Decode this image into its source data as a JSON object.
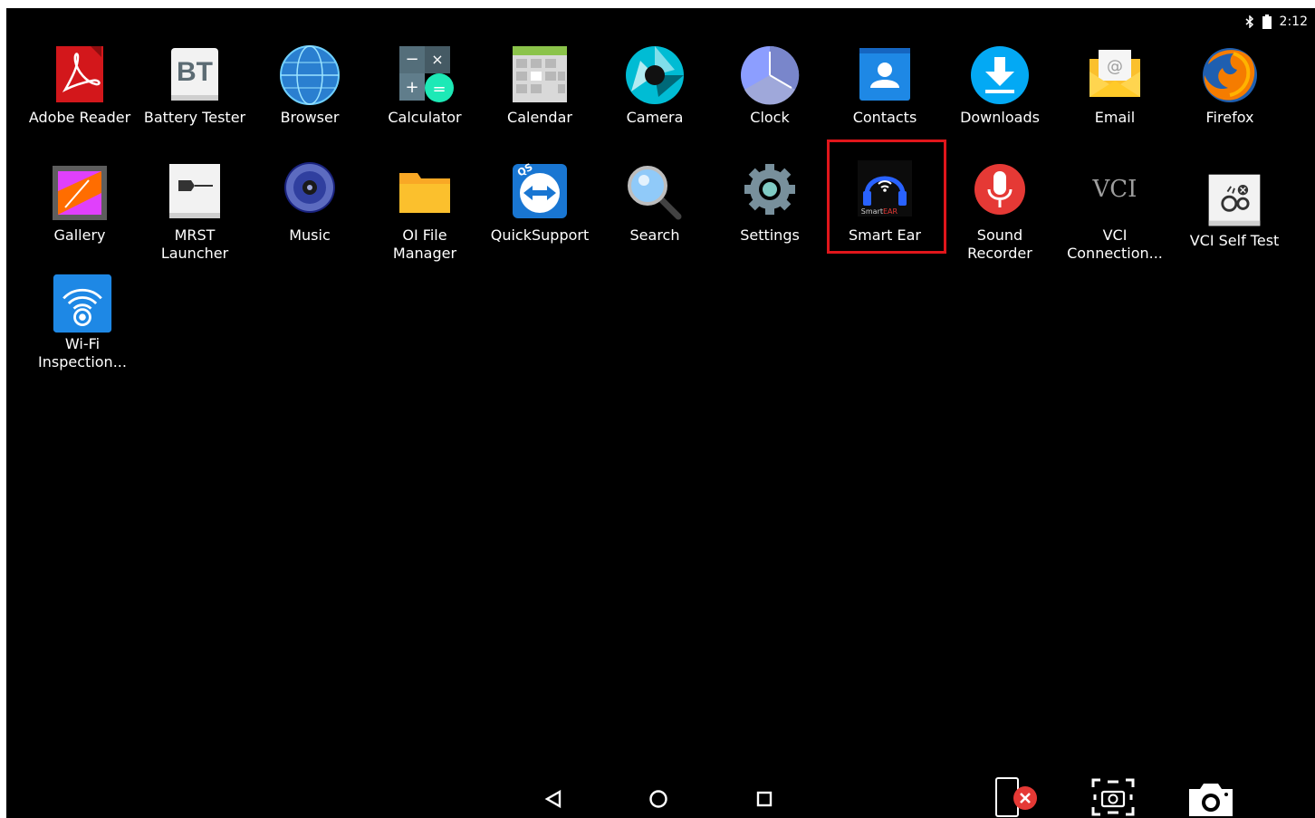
{
  "status_bar": {
    "time": "2:12",
    "icons": [
      "bluetooth-icon",
      "battery-icon"
    ]
  },
  "apps": [
    {
      "label": "Adobe Reader"
    },
    {
      "label": "Battery Tester",
      "icon_text": "BT"
    },
    {
      "label": "Browser"
    },
    {
      "label": "Calculator"
    },
    {
      "label": "Calendar"
    },
    {
      "label": "Camera"
    },
    {
      "label": "Clock"
    },
    {
      "label": "Contacts"
    },
    {
      "label": "Downloads"
    },
    {
      "label": "Email"
    },
    {
      "label": "Firefox"
    },
    {
      "label": "Gallery"
    },
    {
      "label": "MRST\nLauncher"
    },
    {
      "label": "Music"
    },
    {
      "label": "OI File\nManager"
    },
    {
      "label": "QuickSupport",
      "icon_text": "QS"
    },
    {
      "label": "Search"
    },
    {
      "label": "Settings"
    },
    {
      "label": "Smart Ear",
      "icon_text_prefix": "Smart",
      "icon_text_accent": "EAR"
    },
    {
      "label": "Sound\nRecorder"
    },
    {
      "label": "VCI\nConnection...",
      "icon_text": "VCI"
    },
    {
      "label": "VCI Self Test"
    },
    {
      "label": "Wi-Fi\nInspection..."
    }
  ],
  "highlight": {
    "target": "Smart Ear",
    "color": "#e0161b"
  },
  "nav_bar": {
    "buttons": [
      "back-icon",
      "home-icon",
      "recents-icon",
      "close-app-icon",
      "screenshot-region-icon",
      "camera-capture-icon"
    ]
  },
  "colors": {
    "background": "#000000",
    "text": "#ffffff",
    "accent_red": "#e0161b"
  }
}
